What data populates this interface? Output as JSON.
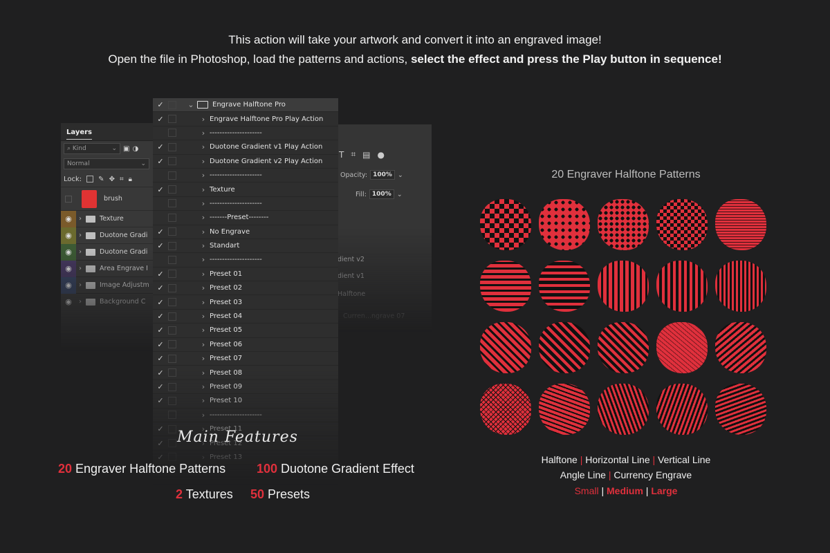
{
  "header": {
    "line1": "This action will take your artwork and  convert it into an engraved image!",
    "line2_plain": "Open the file in Photoshop, load the patterns and actions, ",
    "line2_bold": "select the effect and press the Play button in sequence!"
  },
  "layers_panel": {
    "tab": "Layers",
    "kind": "Kind",
    "blend": "Normal",
    "lock": "Lock:",
    "layers": [
      {
        "name": "brush",
        "thumb": true
      },
      {
        "name": "Texture",
        "color": "#7a5a2a"
      },
      {
        "name": "Duotone Gradi",
        "color": "#6b6a2e"
      },
      {
        "name": "Duotone Gradi",
        "color": "#3c5a34"
      },
      {
        "name": "Area Engrave I",
        "color": "#45375f"
      },
      {
        "name": "Image Adjustm",
        "color": "#354260"
      },
      {
        "name": "Background C",
        "color": "#383838"
      }
    ]
  },
  "props_panel": {
    "opacity_label": "Opacity:",
    "opacity_value": "100%",
    "fill_label": "Fill:",
    "fill_value": "100%",
    "rows": [
      "dient v2",
      "dient v1",
      "Halftone",
      "Curren...ngrave 07"
    ]
  },
  "actions_panel": {
    "rows": [
      {
        "label": "Engrave Halftone Pro",
        "check": true,
        "root": true
      },
      {
        "label": "Engrave Halftone Pro Play Action",
        "check": true
      },
      {
        "label": "---------------------",
        "check": false
      },
      {
        "label": "Duotone Gradient v1 Play Action",
        "check": true
      },
      {
        "label": "Duotone Gradient v2 Play Action",
        "check": true
      },
      {
        "label": "---------------------",
        "check": false
      },
      {
        "label": "Texture",
        "check": true
      },
      {
        "label": "---------------------",
        "check": false
      },
      {
        "label": "-------Preset--------",
        "check": false
      },
      {
        "label": "No Engrave",
        "check": true
      },
      {
        "label": "Standart",
        "check": true
      },
      {
        "label": "---------------------",
        "check": false
      },
      {
        "label": "Preset 01",
        "check": true
      },
      {
        "label": "Preset 02",
        "check": true
      },
      {
        "label": "Preset 03",
        "check": true
      },
      {
        "label": "Preset 04",
        "check": true
      },
      {
        "label": "Preset 05",
        "check": true
      },
      {
        "label": "Preset 06",
        "check": true
      },
      {
        "label": "Preset 07",
        "check": true
      },
      {
        "label": "Preset 08",
        "check": true
      },
      {
        "label": "Preset 09",
        "check": true
      },
      {
        "label": "Preset 10",
        "check": true
      },
      {
        "label": "---------------------",
        "check": false
      },
      {
        "label": "Preset 11",
        "check": true
      },
      {
        "label": "Preset 12",
        "check": true
      },
      {
        "label": "Preset 13",
        "check": true
      }
    ]
  },
  "features": {
    "title": "Main Features",
    "items": [
      {
        "num": "20",
        "text": " Engraver Halftone Patterns"
      },
      {
        "num": "100",
        "text": " Duotone Gradient Effect"
      },
      {
        "num": "2",
        "text": " Textures"
      },
      {
        "num": "50",
        "text": " Presets"
      }
    ]
  },
  "patterns": {
    "title": "20 Engraver Halftone Patterns",
    "categories_line1": [
      "Halftone",
      "Horizontal Line",
      "Vertical Line"
    ],
    "categories_line2": [
      "Angle Line",
      "Currency Engrave"
    ],
    "sizes": [
      "Small",
      "Medium",
      "Large"
    ],
    "separator": "|"
  },
  "colors": {
    "accent": "#e0303c",
    "background": "#1f1f20"
  }
}
